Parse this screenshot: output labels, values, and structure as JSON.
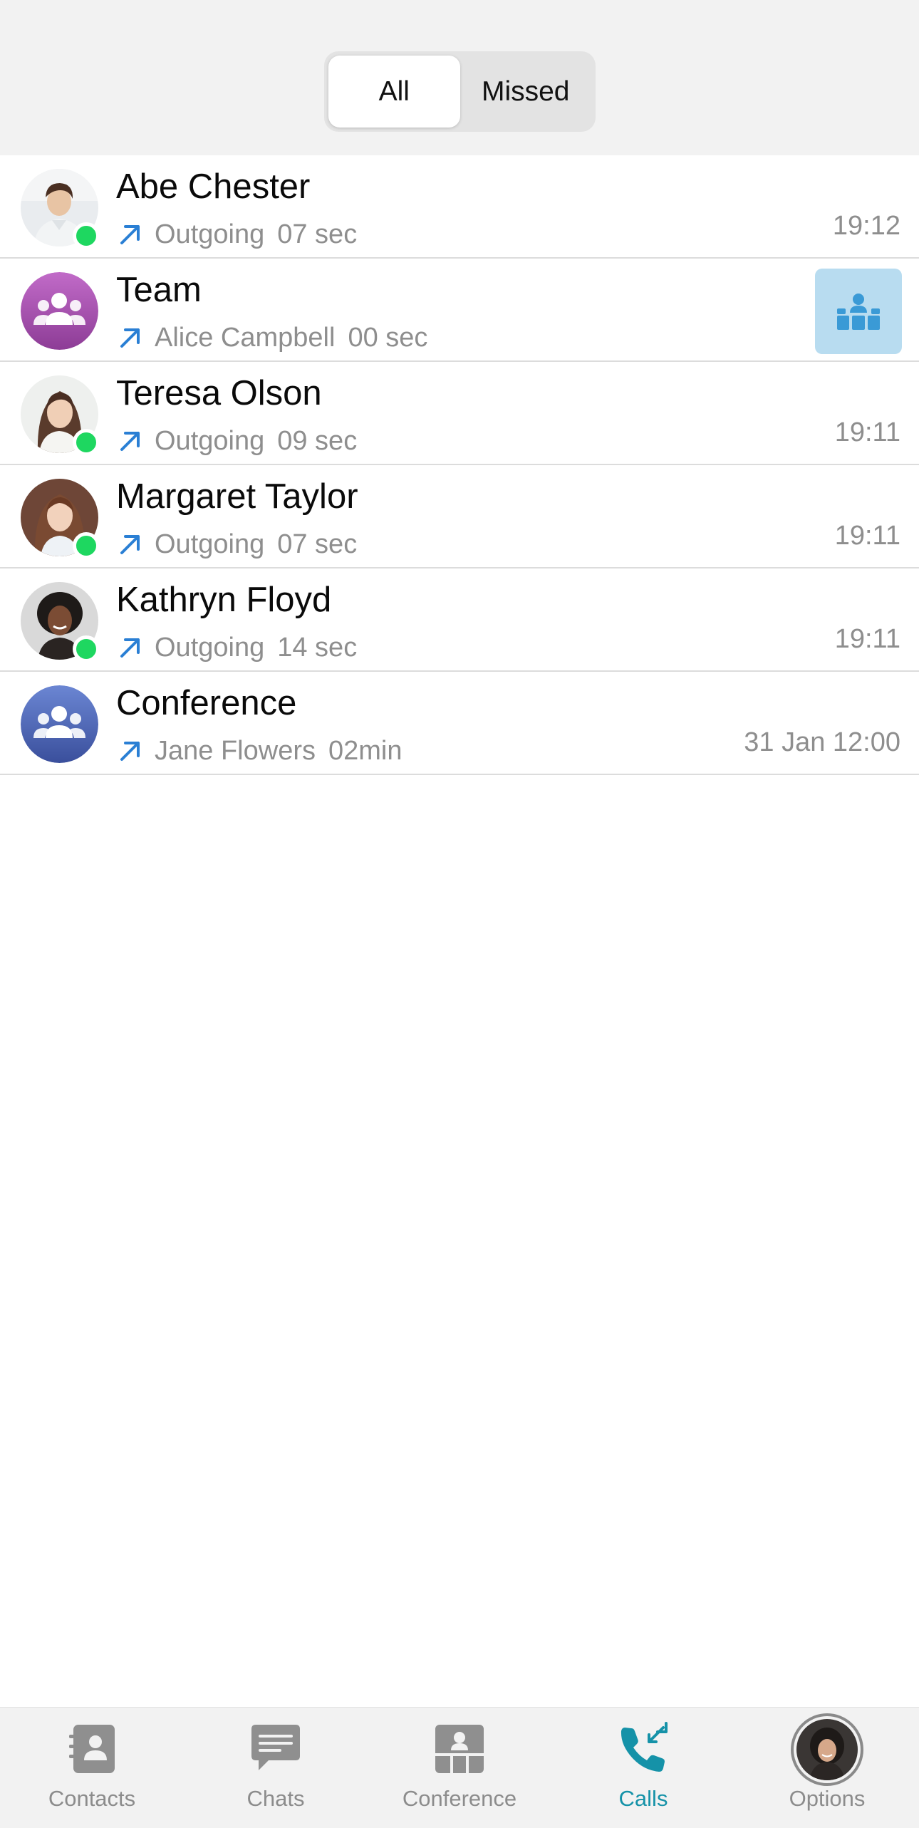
{
  "filter": {
    "all_label": "All",
    "missed_label": "Missed",
    "selected": "All"
  },
  "calls": [
    {
      "name": "Abe Chester",
      "direction": "Outgoing",
      "duration": "07 sec",
      "time": "19:12",
      "online": true,
      "avatar": "photo-man"
    },
    {
      "name": "Team",
      "direction": "Alice Campbell",
      "duration": "00 sec",
      "time": "",
      "online": false,
      "avatar": "group-purple",
      "join_conference": true
    },
    {
      "name": "Teresa Olson",
      "direction": "Outgoing",
      "duration": "09 sec",
      "time": "19:11",
      "online": true,
      "avatar": "photo-woman"
    },
    {
      "name": "Margaret Taylor",
      "direction": "Outgoing",
      "duration": "07 sec",
      "time": "19:11",
      "online": true,
      "avatar": "photo-woman"
    },
    {
      "name": "Kathryn Floyd",
      "direction": "Outgoing",
      "duration": "14 sec",
      "time": "19:11",
      "online": true,
      "avatar": "photo-woman"
    },
    {
      "name": "Conference",
      "direction": "Jane Flowers",
      "duration": "02min",
      "time": "31 Jan 12:00",
      "online": false,
      "avatar": "group-blue"
    }
  ],
  "tabs": [
    {
      "label": "Contacts",
      "icon": "contacts-icon"
    },
    {
      "label": "Chats",
      "icon": "chat-bubble-icon"
    },
    {
      "label": "Conference",
      "icon": "conference-icon"
    },
    {
      "label": "Calls",
      "icon": "phone-calls-icon",
      "active": true
    },
    {
      "label": "Options",
      "icon": "profile-avatar"
    }
  ],
  "colors": {
    "accent": "#1592a8",
    "presence_online": "#1ed760",
    "outgoing_arrow": "#2a7fd4",
    "group_purple": "#a64fae",
    "group_blue": "#4a63b8",
    "conference_button": "#b8dcf0"
  }
}
